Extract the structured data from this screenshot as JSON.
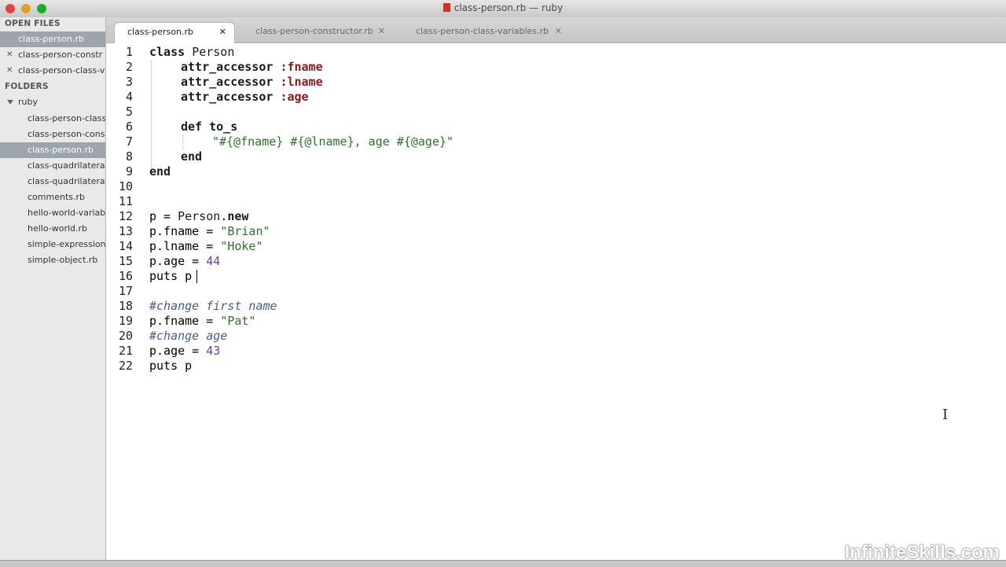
{
  "window": {
    "title": "class-person.rb — ruby"
  },
  "sidebar": {
    "open_files_header": "OPEN FILES",
    "open_files": [
      {
        "label": "class-person.rb",
        "selected": true
      },
      {
        "label": "class-person-constr",
        "selected": false
      },
      {
        "label": "class-person-class-v",
        "selected": false
      }
    ],
    "folders_header": "FOLDERS",
    "folder": "ruby",
    "files": [
      {
        "label": "class-person-class",
        "selected": false
      },
      {
        "label": "class-person-cons",
        "selected": false
      },
      {
        "label": "class-person.rb",
        "selected": true
      },
      {
        "label": "class-quadrilateral",
        "selected": false
      },
      {
        "label": "class-quadrilateral",
        "selected": false
      },
      {
        "label": "comments.rb",
        "selected": false
      },
      {
        "label": "hello-world-variab",
        "selected": false
      },
      {
        "label": "hello-world.rb",
        "selected": false
      },
      {
        "label": "simple-expression",
        "selected": false
      },
      {
        "label": "simple-object.rb",
        "selected": false
      }
    ]
  },
  "tabs": [
    {
      "label": "class-person.rb",
      "active": true
    },
    {
      "label": "class-person-constructor.rb",
      "active": false
    },
    {
      "label": "class-person-class-variables.rb",
      "active": false
    }
  ],
  "editor": {
    "line_numbers": [
      "1",
      "2",
      "3",
      "4",
      "5",
      "6",
      "7",
      "8",
      "9",
      "10",
      "11",
      "12",
      "13",
      "14",
      "15",
      "16",
      "17",
      "18",
      "19",
      "20",
      "21",
      "22"
    ],
    "tokens": {
      "l1": [
        "class",
        "Person"
      ],
      "l2": [
        "attr_accessor",
        ":fname"
      ],
      "l3": [
        "attr_accessor",
        ":lname"
      ],
      "l4": [
        "attr_accessor",
        ":age"
      ],
      "l6": [
        "def",
        "to_s"
      ],
      "l7": [
        "\"#{@fname} #{@lname}, age #{@age}\""
      ],
      "l8": [
        "end"
      ],
      "l9": [
        "end"
      ],
      "l12": [
        "p = ",
        "Person",
        ".",
        "new"
      ],
      "l13": [
        "p.fname = ",
        "\"Brian\""
      ],
      "l14": [
        "p.lname = ",
        "\"Hoke\""
      ],
      "l15": [
        "p.age = ",
        "44"
      ],
      "l16": [
        "puts p"
      ],
      "l18": [
        "#change first name"
      ],
      "l19": [
        "p.fname = ",
        "\"Pat\""
      ],
      "l20": [
        "#change age"
      ],
      "l21": [
        "p.age = ",
        "43"
      ],
      "l22": [
        "puts p"
      ]
    }
  },
  "watermark": "InfiniteSkills.com",
  "colors": {
    "sidebar_selected": "#9da4ab",
    "symbol": "#8b1a1a",
    "string": "#2f6f2f",
    "number": "#6a3fa0",
    "comment": "#4b5d86"
  }
}
